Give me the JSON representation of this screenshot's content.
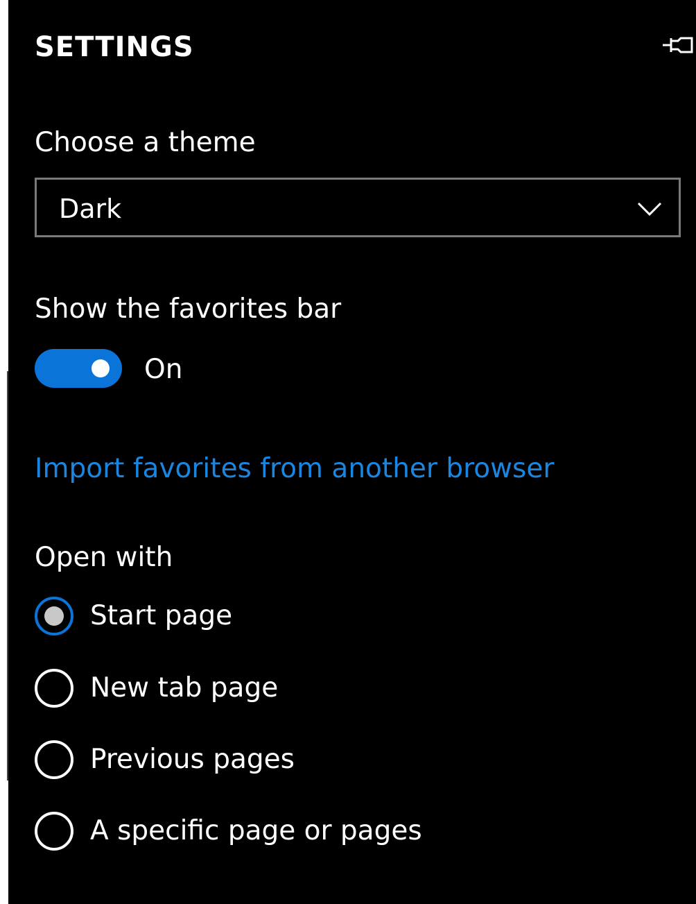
{
  "header": {
    "title": "SETTINGS",
    "pin_icon": "pin-icon"
  },
  "theme": {
    "label": "Choose a theme",
    "selected": "Dark",
    "chevron_icon": "chevron-down-icon"
  },
  "favorites_bar": {
    "label": "Show the favorites bar",
    "state": "On",
    "accent_color": "#0a74d8"
  },
  "import_link": {
    "text": "Import favorites from another browser",
    "color": "#1a86e0"
  },
  "open_with": {
    "label": "Open with",
    "options": [
      {
        "label": "Start page",
        "selected": true
      },
      {
        "label": "New tab page",
        "selected": false
      },
      {
        "label": "Previous pages",
        "selected": false
      },
      {
        "label": "A specific page or pages",
        "selected": false
      }
    ]
  }
}
